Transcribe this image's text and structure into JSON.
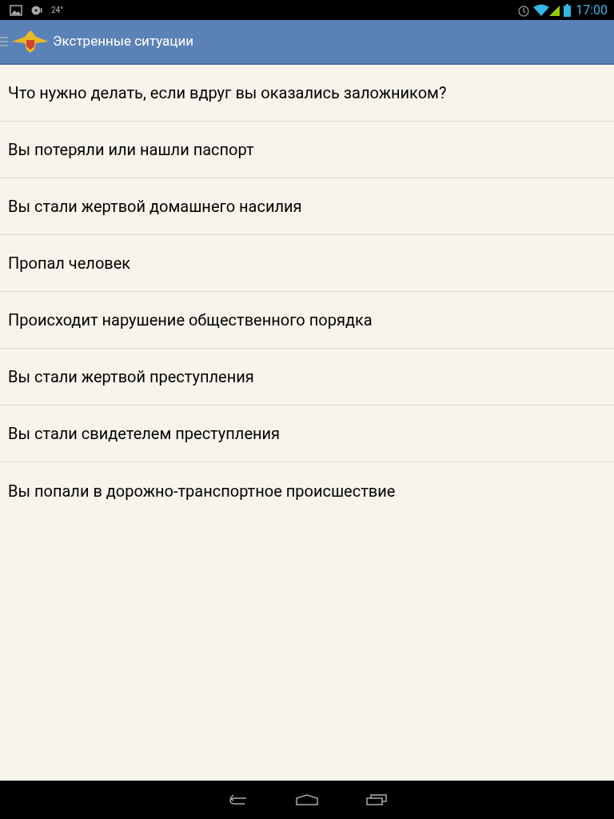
{
  "status_bar": {
    "temperature": "24°",
    "time": "17:00"
  },
  "action_bar": {
    "title": "Экстренные ситуации"
  },
  "items": [
    {
      "label": "Что нужно делать, если вдруг вы оказались заложником?"
    },
    {
      "label": "Вы потеряли или нашли паспорт"
    },
    {
      "label": "Вы стали жертвой домашнего насилия"
    },
    {
      "label": "Пропал человек"
    },
    {
      "label": "Происходит нарушение общественного порядка"
    },
    {
      "label": "Вы стали жертвой преступления"
    },
    {
      "label": "Вы стали свидетелем преступления"
    },
    {
      "label": "Вы попали в дорожно-транспортное происшествие"
    }
  ]
}
